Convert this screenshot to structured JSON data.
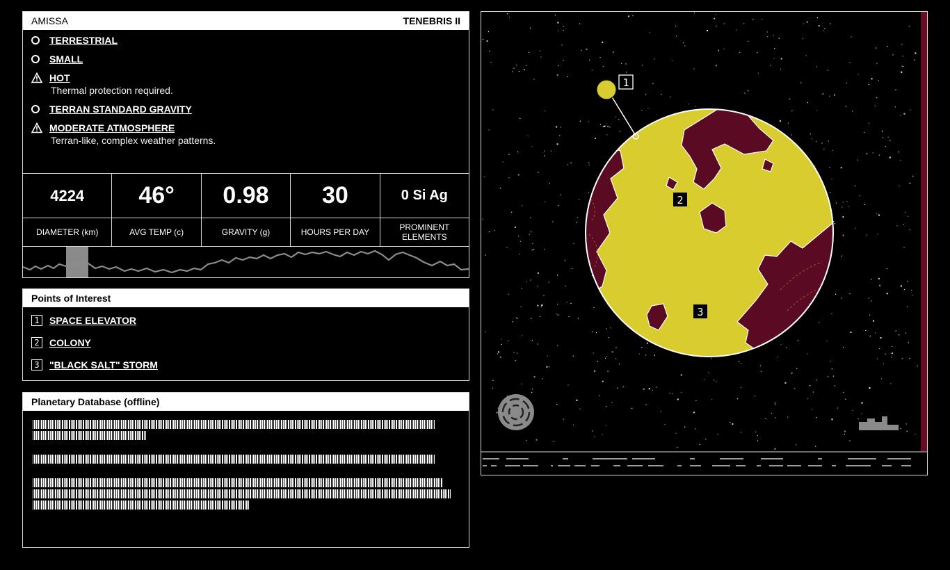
{
  "planet": {
    "name": "AMISSA",
    "system": "TENEBRIS II"
  },
  "properties": [
    {
      "icon": "circle-icon",
      "label": "TERRESTRIAL",
      "desc": ""
    },
    {
      "icon": "circle-icon",
      "label": "SMALL",
      "desc": ""
    },
    {
      "icon": "warning-icon",
      "label": "HOT",
      "desc": "Thermal protection required."
    },
    {
      "icon": "circle-icon",
      "label": "TERRAN STANDARD GRAVITY",
      "desc": ""
    },
    {
      "icon": "warning-icon",
      "label": "MODERATE ATMOSPHERE",
      "desc": "Terran-like, complex weather patterns."
    }
  ],
  "stats": [
    {
      "value": "4224",
      "label": "DIAMETER (km)"
    },
    {
      "value": "46°",
      "label": "AVG TEMP (c)"
    },
    {
      "value": "0.98",
      "label": "GRAVITY (g)"
    },
    {
      "value": "30",
      "label": "HOURS PER DAY"
    },
    {
      "value": "0 Si Ag",
      "label": "PROMINENT ELEMENTS"
    }
  ],
  "poi": {
    "title": "Points of Interest",
    "items": [
      {
        "num": "1",
        "label": "SPACE ELEVATOR"
      },
      {
        "num": "2",
        "label": "COLONY"
      },
      {
        "num": "3",
        "label": "\"BLACK SALT\" STORM"
      }
    ]
  },
  "database": {
    "title": "Planetary Database (offline)"
  },
  "map": {
    "markers": [
      "1",
      "2",
      "3"
    ]
  },
  "colors": {
    "planet_yellow": "#d8cc2e",
    "terrain_maroon": "#5a0a23",
    "panel_white": "#ffffff",
    "accent_red": "#6a0c26"
  }
}
